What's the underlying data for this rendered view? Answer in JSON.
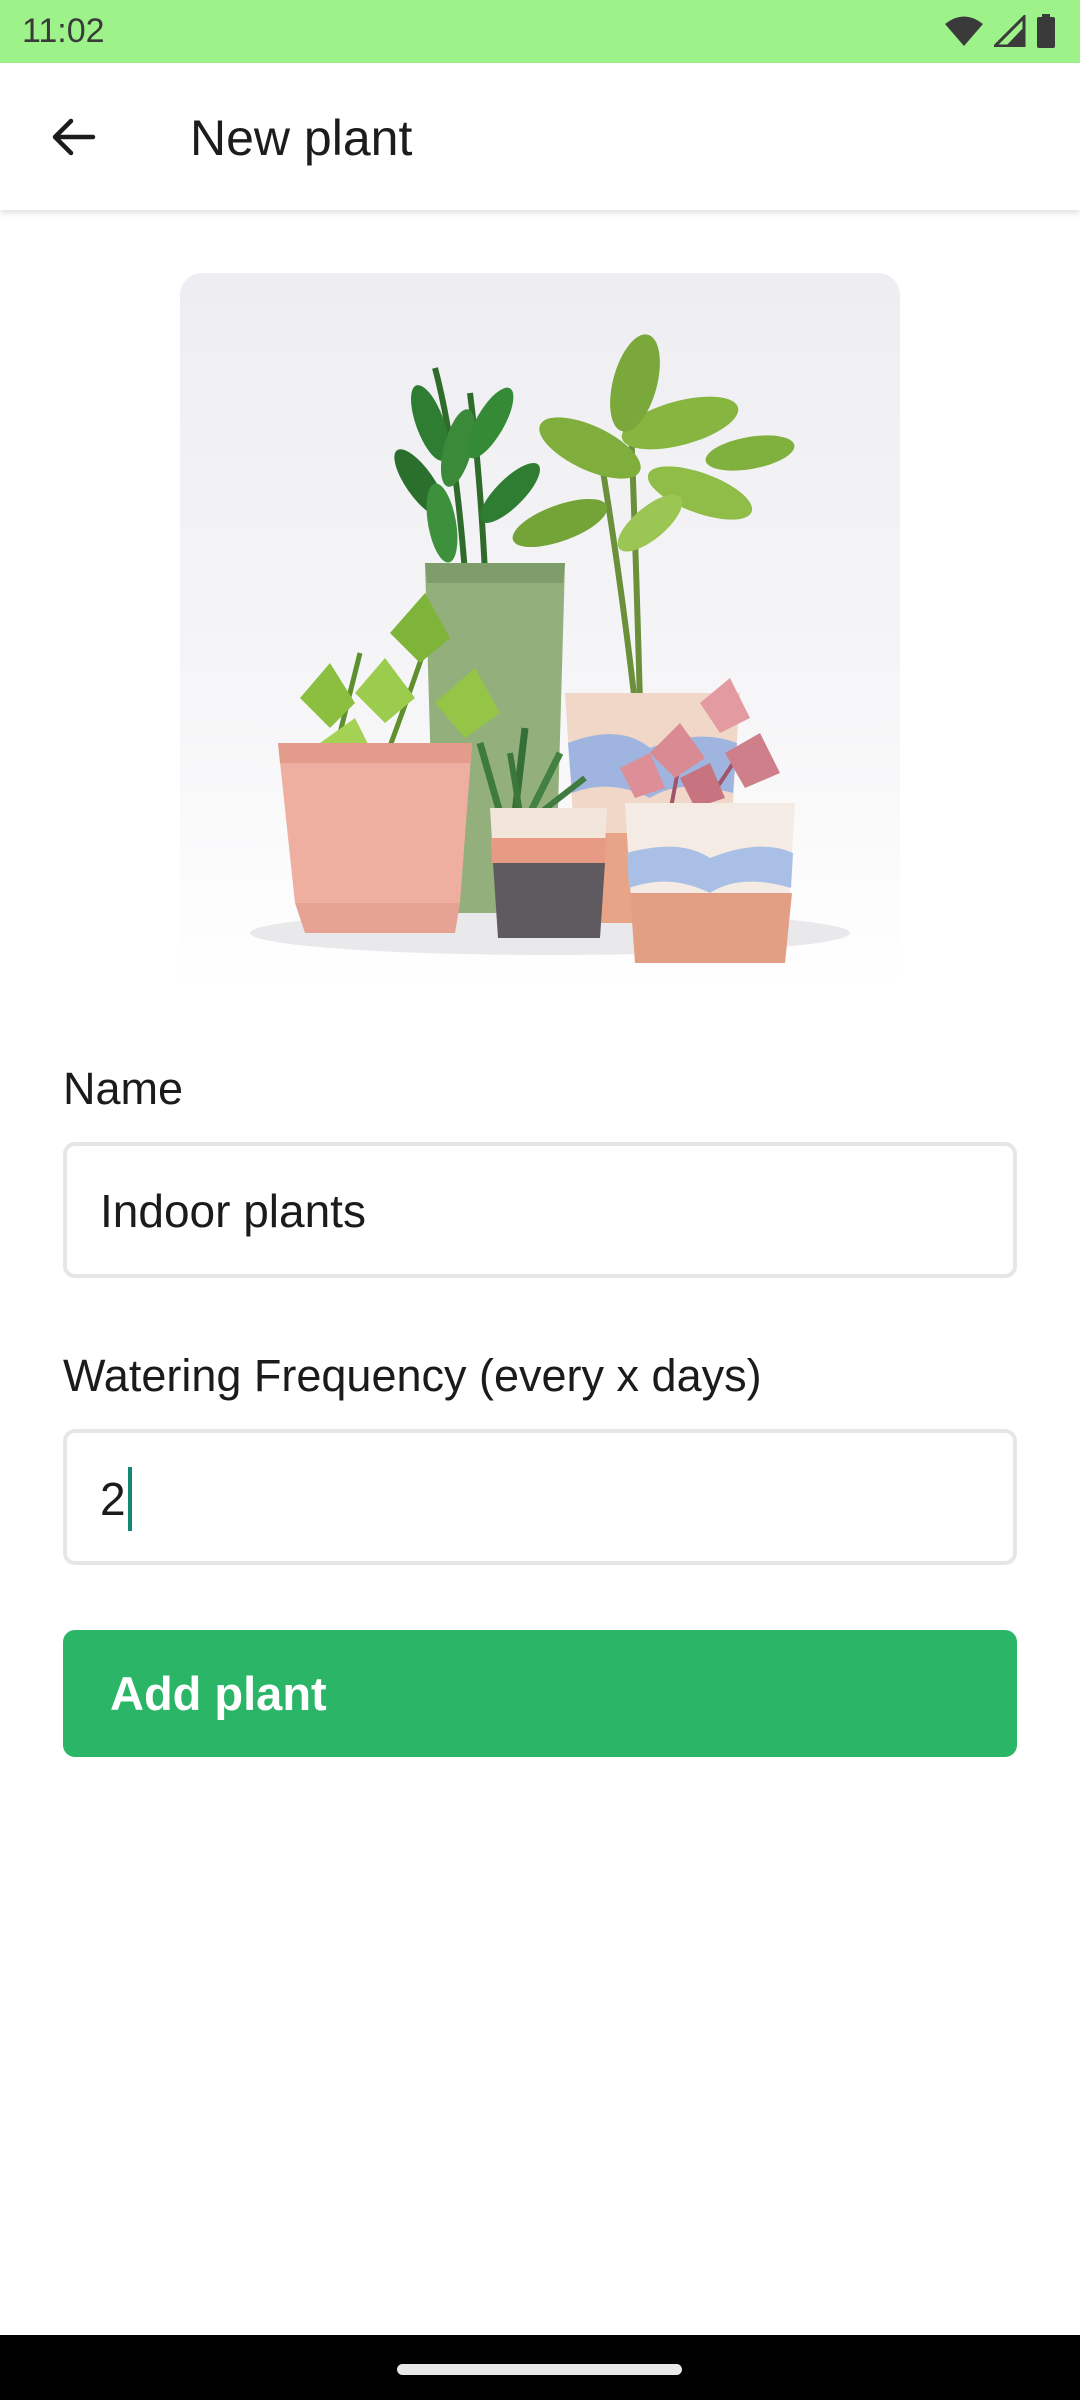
{
  "status_bar": {
    "time": "11:02",
    "icons": [
      "wifi-icon",
      "cellular-signal-icon",
      "battery-icon"
    ],
    "background": "#9ef28a"
  },
  "app_bar": {
    "back_icon": "arrow-back-icon",
    "title": "New plant"
  },
  "plant_image": {
    "description_icon": "potted-plants-photo"
  },
  "form": {
    "name": {
      "label": "Name",
      "value": "Indoor plants"
    },
    "watering": {
      "label": "Watering Frequency (every x days)",
      "value": "2"
    },
    "submit_label": "Add plant"
  },
  "colors": {
    "primary": "#2bb567",
    "caret": "#128a72",
    "status_bar": "#9ef28a"
  }
}
